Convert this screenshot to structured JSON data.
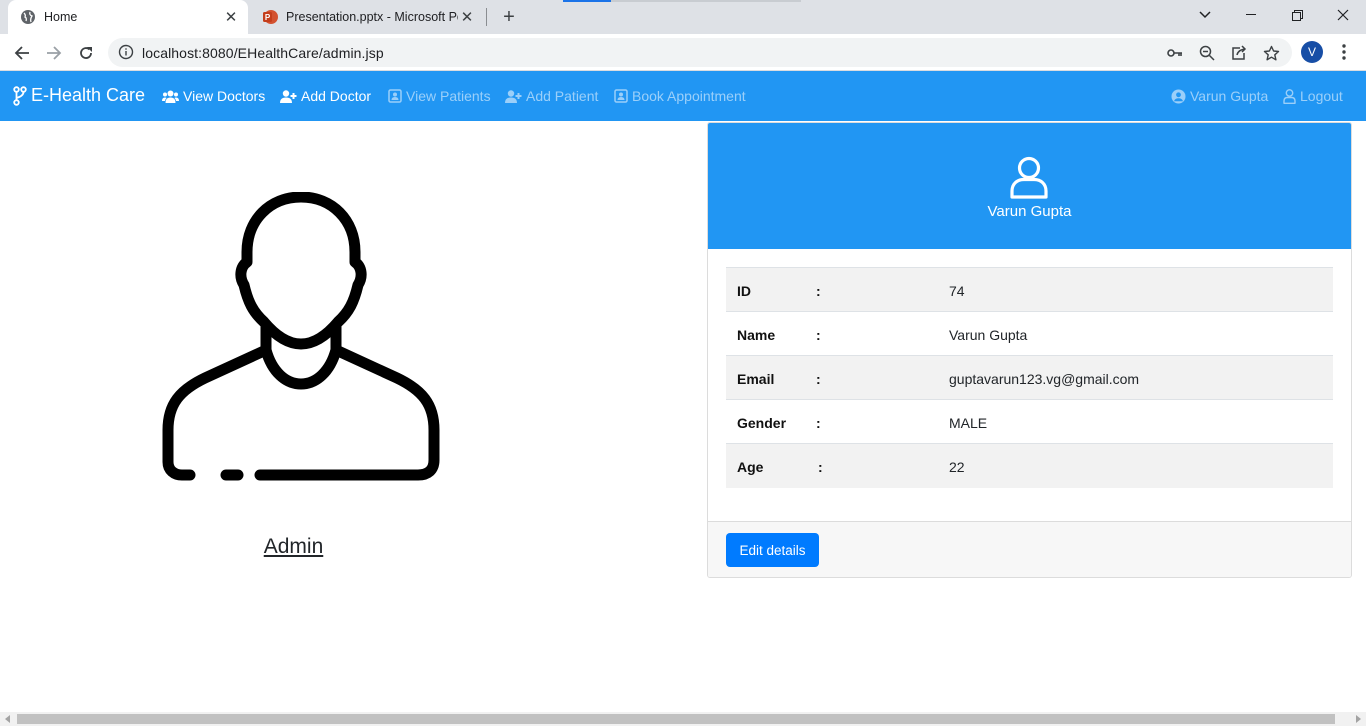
{
  "browser": {
    "tabs": [
      {
        "title": "Home",
        "icon": "globe-icon"
      },
      {
        "title": "Presentation.pptx - Microsoft PowerPoint",
        "icon": "powerpoint-icon"
      }
    ],
    "url": "localhost:8080/EHealthCare/admin.jsp",
    "profile_initial": "V"
  },
  "navbar": {
    "brand": "E-Health Care",
    "items": [
      {
        "label": "View Doctors",
        "icon": "users-icon",
        "enabled": true
      },
      {
        "label": "Add Doctor",
        "icon": "user-plus-icon",
        "enabled": true
      },
      {
        "label": "View Patients",
        "icon": "id-badge-icon",
        "enabled": false
      },
      {
        "label": "Add Patient",
        "icon": "user-plus-icon",
        "enabled": false
      },
      {
        "label": "Book Appointment",
        "icon": "id-badge-icon",
        "enabled": false
      }
    ],
    "user": "Varun Gupta",
    "logout": "Logout"
  },
  "profile": {
    "label": "Admin"
  },
  "card": {
    "name": "Varun Gupta",
    "rows": [
      {
        "key": "ID",
        "sep": ":",
        "value": "74"
      },
      {
        "key": "Name",
        "sep": ":",
        "value": "Varun Gupta"
      },
      {
        "key": "Email",
        "sep": ":",
        "value": "guptavarun123.vg@gmail.com"
      },
      {
        "key": "Gender",
        "sep": ":",
        "value": "MALE"
      },
      {
        "key": "Age",
        "sep": ":",
        "value": "22"
      }
    ],
    "edit_button": "Edit details"
  },
  "colors": {
    "primary": "#2196f3",
    "button": "#007bff"
  }
}
